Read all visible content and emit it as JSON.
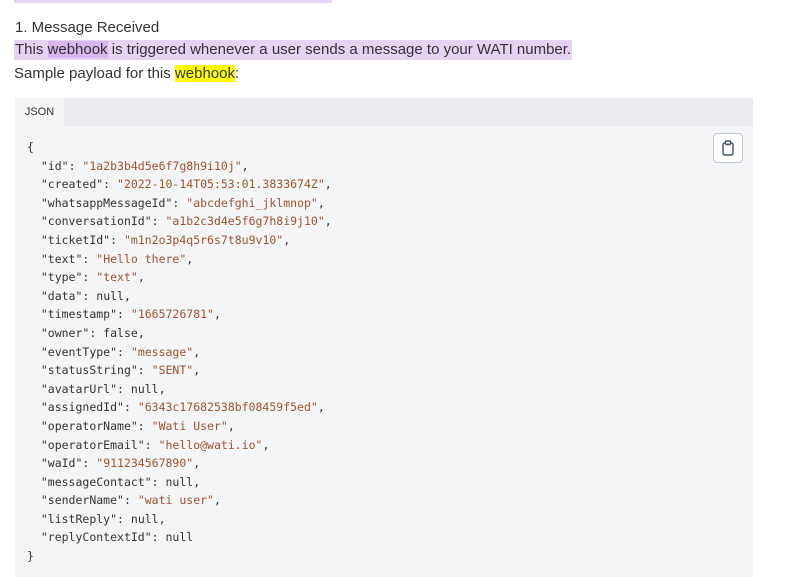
{
  "heading": "1. Message Received",
  "intro": {
    "before": "This ",
    "highlight": "webhook",
    "after": " is triggered whenever a user sends a message to your WATI number."
  },
  "sample": {
    "before": "Sample payload for this ",
    "highlight": "webhook",
    "after": ":"
  },
  "code_block": {
    "tab_label": "JSON",
    "open_brace": "{",
    "close_brace": "}",
    "fields": [
      {
        "key": "id",
        "value": "\"1a2b3b4d5e6f7g8h9i10j\"",
        "type": "string"
      },
      {
        "key": "created",
        "value": "\"2022-10-14T05:53:01.3833674Z\"",
        "type": "string"
      },
      {
        "key": "whatsappMessageId",
        "value": "\"abcdefghi_jklmnop\"",
        "type": "string"
      },
      {
        "key": "conversationId",
        "value": "\"a1b2c3d4e5f6g7h8i9j10\"",
        "type": "string"
      },
      {
        "key": "ticketId",
        "value": "\"m1n2o3p4q5r6s7t8u9v10\"",
        "type": "string"
      },
      {
        "key": "text",
        "value": "\"Hello there\"",
        "type": "string"
      },
      {
        "key": "type",
        "value": "\"text\"",
        "type": "string"
      },
      {
        "key": "data",
        "value": "null",
        "type": "literal"
      },
      {
        "key": "timestamp",
        "value": "\"1665726781\"",
        "type": "string"
      },
      {
        "key": "owner",
        "value": "false",
        "type": "literal"
      },
      {
        "key": "eventType",
        "value": "\"message\"",
        "type": "string"
      },
      {
        "key": "statusString",
        "value": "\"SENT\"",
        "type": "string"
      },
      {
        "key": "avatarUrl",
        "value": "null",
        "type": "literal"
      },
      {
        "key": "assignedId",
        "value": "\"6343c17682538bf08459f5ed\"",
        "type": "string"
      },
      {
        "key": "operatorName",
        "value": "\"Wati User\"",
        "type": "string"
      },
      {
        "key": "operatorEmail",
        "value": "\"hello@wati.io\"",
        "type": "string"
      },
      {
        "key": "waId",
        "value": "\"911234567890\"",
        "type": "string"
      },
      {
        "key": "messageContact",
        "value": "null",
        "type": "literal"
      },
      {
        "key": "senderName",
        "value": "\"wati user\"",
        "type": "string"
      },
      {
        "key": "listReply",
        "value": "null",
        "type": "literal"
      },
      {
        "key": "replyContextId",
        "value": "null",
        "type": "literal"
      }
    ],
    "copy_icon": "clipboard-icon"
  },
  "colors": {
    "intro_bg": "#e6d3f3",
    "intro_highlight": "#d7b7ee",
    "search_highlight": "#ffff00",
    "code_bg": "#f4f5f7",
    "string_color": "#a0522d"
  }
}
